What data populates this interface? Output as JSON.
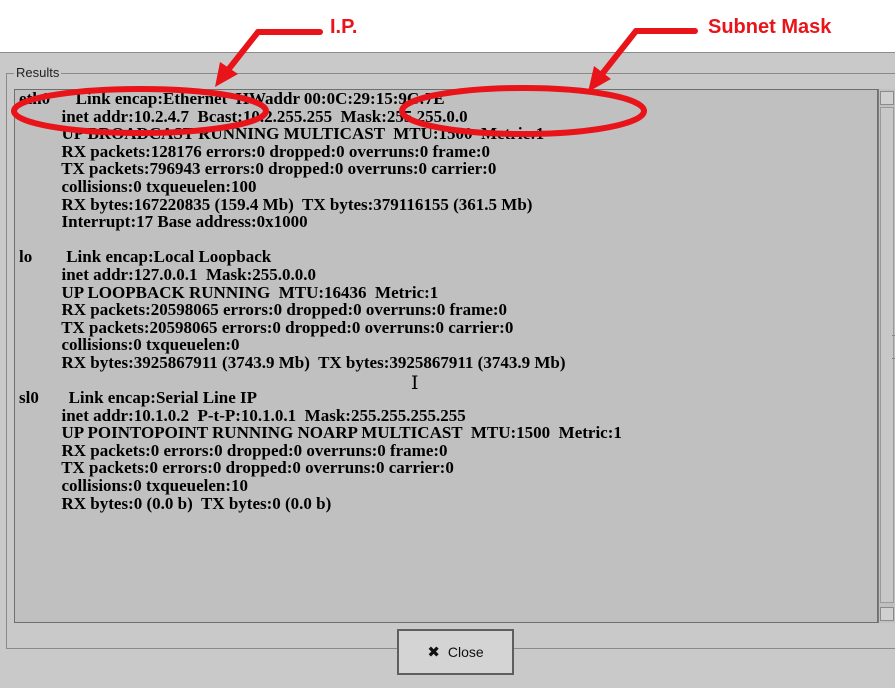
{
  "annotations": {
    "ip_label": "I.P.",
    "subnet_label": "Subnet Mask",
    "color": "#e8141a"
  },
  "dialog": {
    "section_title": "Results",
    "output_text": "eth0      Link encap:Ethernet  HWaddr 00:0C:29:15:9C:7E\n          inet addr:10.2.4.7  Bcast:10.2.255.255  Mask:255.255.0.0\n          UP BROADCAST RUNNING MULTICAST  MTU:1500  Metric:1\n          RX packets:128176 errors:0 dropped:0 overruns:0 frame:0\n          TX packets:796943 errors:0 dropped:0 overruns:0 carrier:0\n          collisions:0 txqueuelen:100\n          RX bytes:167220835 (159.4 Mb)  TX bytes:379116155 (361.5 Mb)\n          Interrupt:17 Base address:0x1000\n\nlo        Link encap:Local Loopback\n          inet addr:127.0.0.1  Mask:255.0.0.0\n          UP LOOPBACK RUNNING  MTU:16436  Metric:1\n          RX packets:20598065 errors:0 dropped:0 overruns:0 frame:0\n          TX packets:20598065 errors:0 dropped:0 overruns:0 carrier:0\n          collisions:0 txqueuelen:0\n          RX bytes:3925867911 (3743.9 Mb)  TX bytes:3925867911 (3743.9 Mb)\n\nsl0       Link encap:Serial Line IP\n          inet addr:10.1.0.2  P-t-P:10.1.0.1  Mask:255.255.255.255\n          UP POINTOPOINT RUNNING NOARP MULTICAST  MTU:1500  Metric:1\n          RX packets:0 errors:0 dropped:0 overruns:0 frame:0\n          TX packets:0 errors:0 dropped:0 overruns:0 carrier:0\n          collisions:0 txqueuelen:10\n          RX bytes:0 (0.0 b)  TX bytes:0 (0.0 b)",
    "close_label": "Close",
    "close_icon": "x-icon"
  }
}
